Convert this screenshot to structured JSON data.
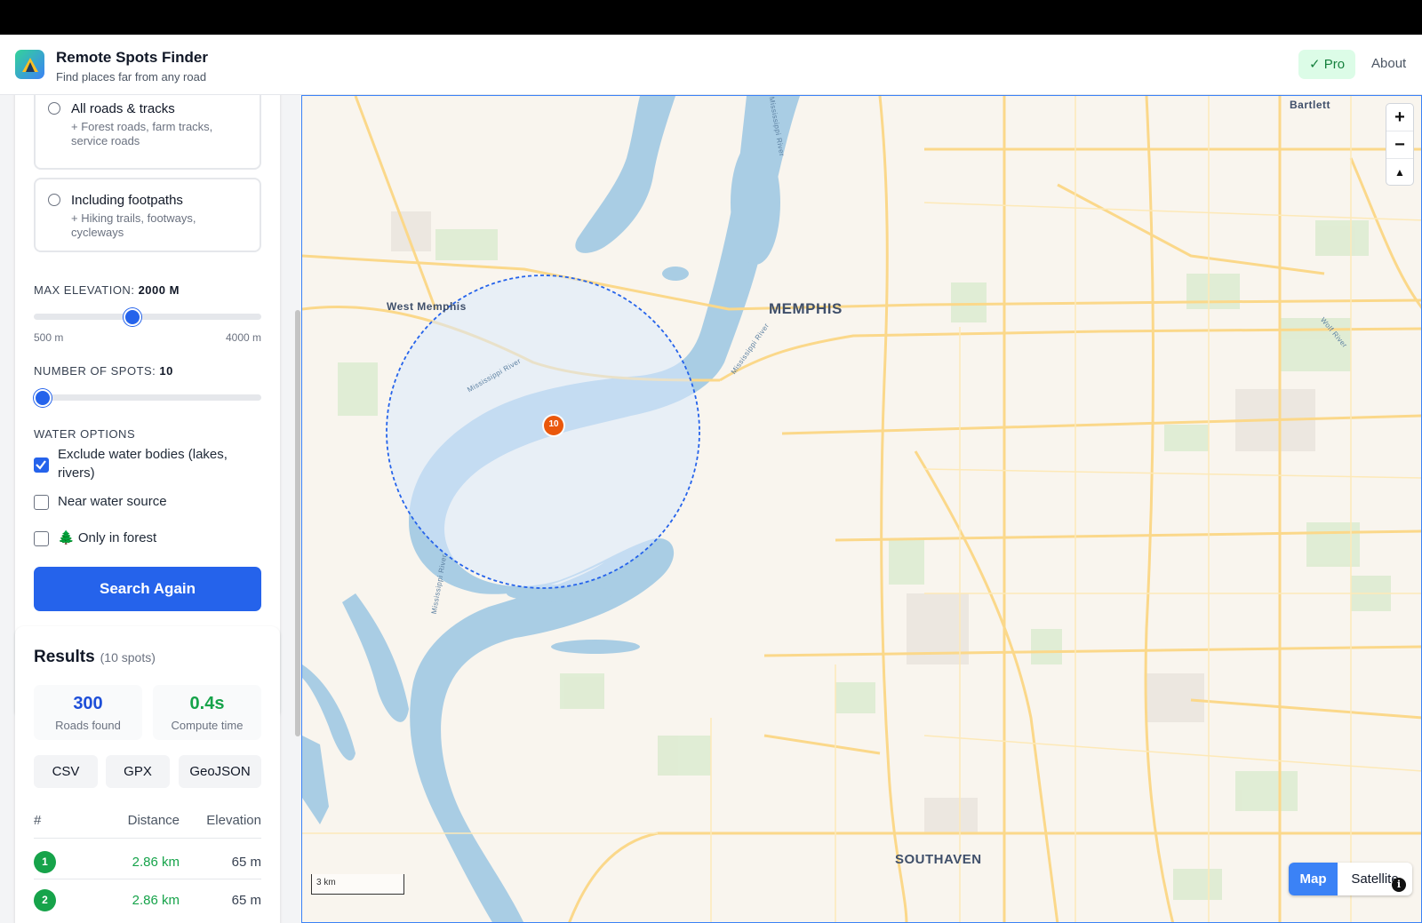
{
  "header": {
    "title": "Remote Spots Finder",
    "subtitle": "Find places far from any road",
    "pro_label": "✓ Pro",
    "about_label": "About"
  },
  "road_options": [
    {
      "title": "All roads & tracks",
      "desc": "+ Forest roads, farm tracks, service roads"
    },
    {
      "title": "Including footpaths",
      "desc": "+ Hiking trails, footways, cycleways"
    }
  ],
  "elevation": {
    "label": "Max elevation:",
    "value": "2000 m",
    "min_label": "500 m",
    "max_label": "4000 m",
    "fraction": 0.43
  },
  "spots": {
    "label": "Number of spots:",
    "value": "10",
    "fraction": 0.0
  },
  "water": {
    "label": "Water options",
    "options": [
      {
        "label": "Exclude water bodies (lakes, rivers)",
        "checked": true
      },
      {
        "label": "Near water source",
        "checked": false
      },
      {
        "label": "🌲 Only in forest",
        "checked": false
      }
    ]
  },
  "search_button": "Search Again",
  "results": {
    "title": "Results",
    "count": "(10 spots)",
    "stats": [
      {
        "value": "300",
        "label": "Roads found",
        "color": "#1d4ed8"
      },
      {
        "value": "0.4s",
        "label": "Compute time",
        "color": "#16a34a"
      }
    ],
    "exports": [
      "CSV",
      "GPX",
      "GeoJSON"
    ],
    "columns": [
      "#",
      "Distance",
      "Elevation"
    ],
    "rows": [
      {
        "rank": "1",
        "distance": "2.86 km",
        "elevation": "65 m"
      },
      {
        "rank": "2",
        "distance": "2.86 km",
        "elevation": "65 m"
      }
    ]
  },
  "map": {
    "labels": {
      "bartlett": "Bartlett",
      "west_memphis": "West Memphis",
      "memphis": "MEMPHIS",
      "southaven": "SOUTHAVEN",
      "river1": "Mississippi River",
      "river2": "Mississippi River",
      "river3": "Mississippi River",
      "river4": "Mississippi River",
      "wolf_river": "Wolf River"
    },
    "marker_label": "10",
    "scale_label": "3 km",
    "map_type": {
      "map": "Map",
      "satellite": "Satellite"
    },
    "zoom_in": "+",
    "zoom_out": "−",
    "compass": "▲",
    "info": "i",
    "colors": {
      "water": "#a9cde4",
      "road": "#fbd88a",
      "park": "#dcebd0",
      "circle": "#2563eb"
    }
  }
}
